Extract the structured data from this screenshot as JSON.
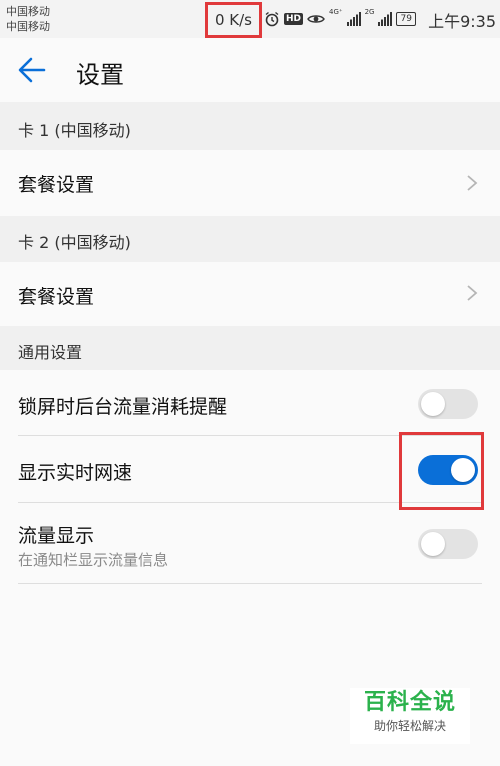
{
  "status_bar": {
    "carrier_1": "中国移动",
    "carrier_2": "中国移动",
    "net_speed": "0 K/s",
    "hd_badge": "HD",
    "signal_1_tag": "4G⁺",
    "signal_2_tag": "2G",
    "battery": "79",
    "time": "上午9:35"
  },
  "app_bar": {
    "title": "设置"
  },
  "sections": {
    "card1": {
      "header": "卡 1 (中国移动)",
      "package_label": "套餐设置"
    },
    "card2": {
      "header": "卡 2 (中国移动)",
      "package_label": "套餐设置"
    },
    "general": {
      "header": "通用设置",
      "lockscreen_alert_label": "锁屏时后台流量消耗提醒",
      "lockscreen_alert_on": false,
      "realtime_speed_label": "显示实时网速",
      "realtime_speed_on": true,
      "traffic_display_label": "流量显示",
      "traffic_display_sub": "在通知栏显示流量信息",
      "traffic_display_on": false
    }
  },
  "watermark": {
    "title": "百科全说",
    "subtitle": "助你轻松解决"
  },
  "colors": {
    "accent": "#0a6fd8",
    "highlight": "#e0393b",
    "watermark_green": "#2bb24c"
  }
}
